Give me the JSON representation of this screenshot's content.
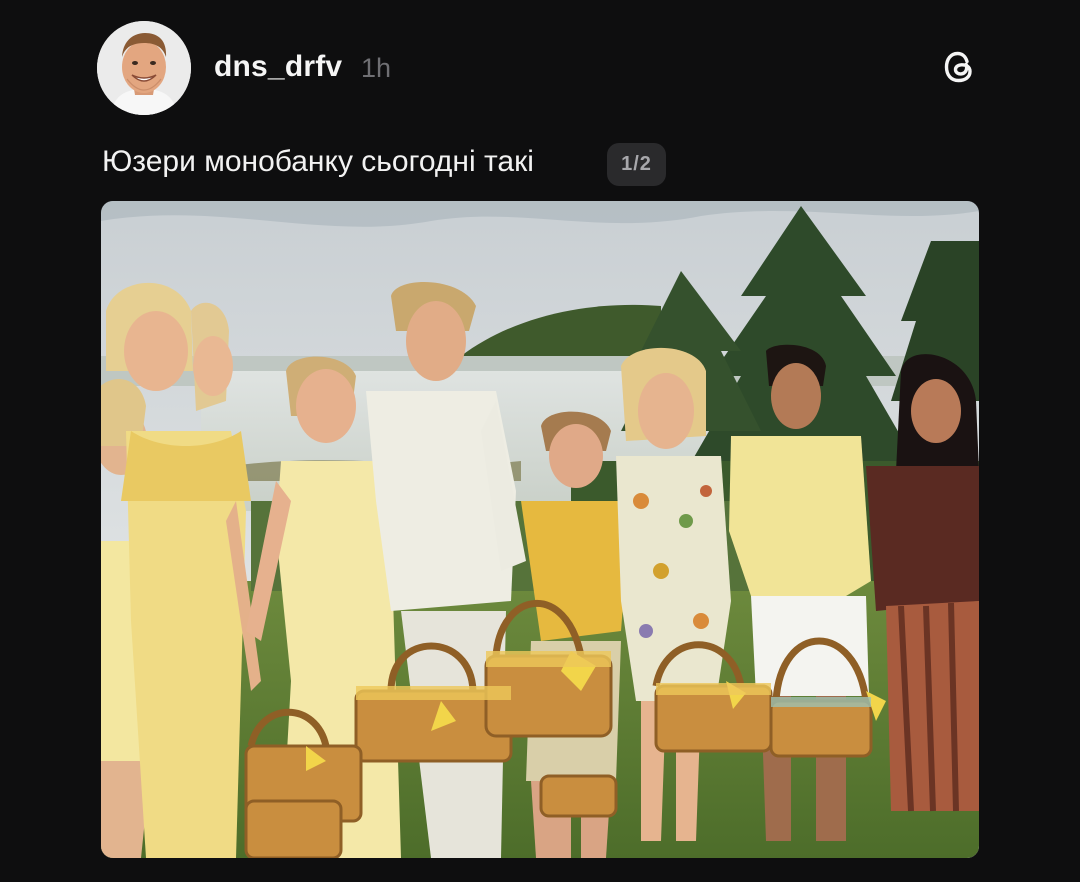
{
  "post": {
    "author": {
      "username": "dns_drfv",
      "time_ago": "1h"
    },
    "caption": "Юзери монобанку сьогодні такі",
    "pager": "1/2",
    "brand_icon": "threads-icon",
    "media": {
      "type": "photo",
      "current": 1,
      "total": 2
    }
  },
  "colors": {
    "background": "#0e0e0f",
    "text": "#f2f2f2",
    "muted": "#6f6f73",
    "pager_bg": "#2a2a2c"
  }
}
